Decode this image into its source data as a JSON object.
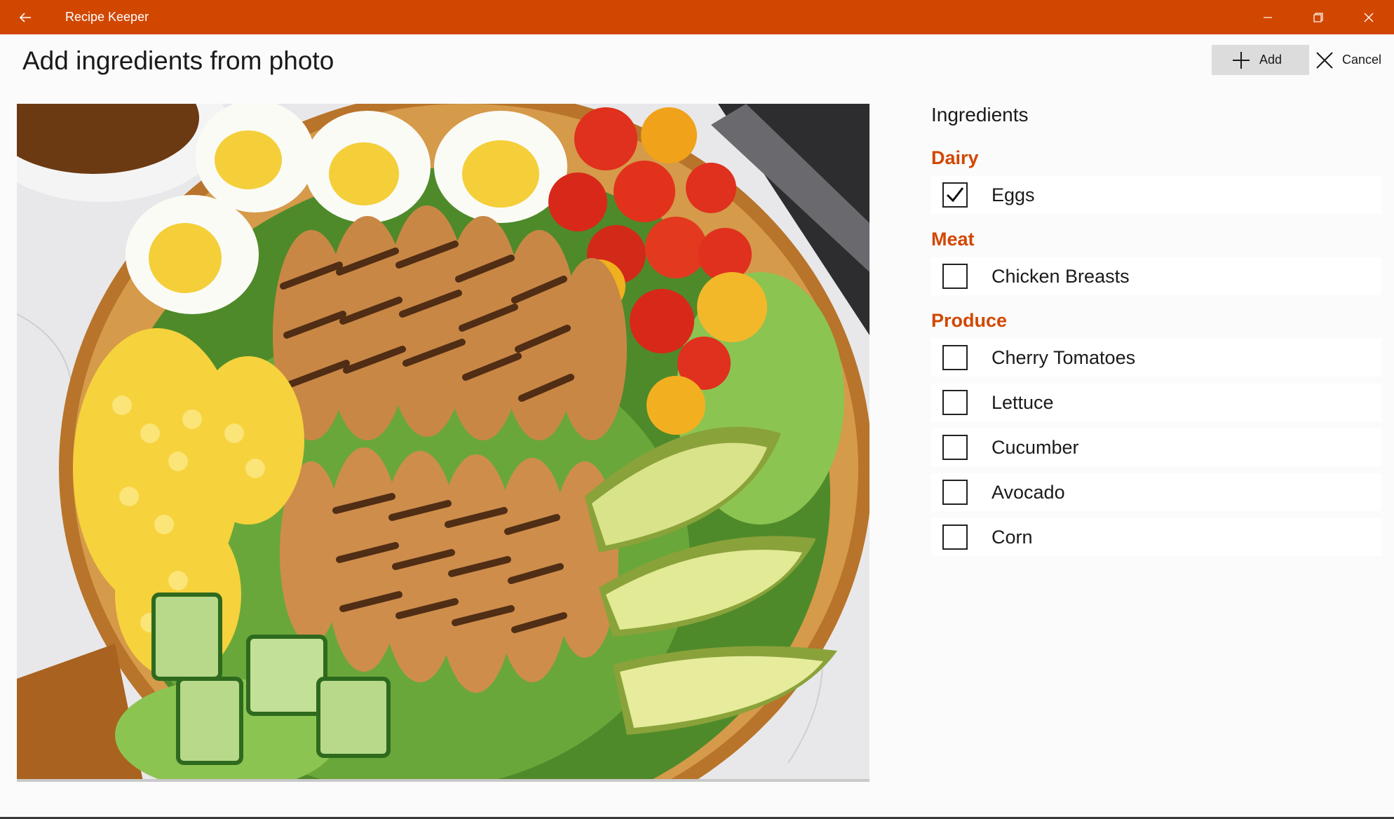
{
  "window": {
    "app_title": "Recipe Keeper",
    "back_icon": "arrow-left-icon",
    "controls": [
      "minimize-icon",
      "restore-icon",
      "close-icon"
    ],
    "accent_color": "#d14700"
  },
  "header": {
    "page_title": "Add ingredients from photo",
    "add_label": "Add",
    "cancel_label": "Cancel"
  },
  "photo": {
    "alt": "Cobb salad with grilled chicken, eggs, cherry tomatoes, avocado, corn and cucumber"
  },
  "ingredients": {
    "heading": "Ingredients",
    "categories": [
      {
        "name": "Dairy",
        "items": [
          {
            "label": "Eggs",
            "checked": true
          }
        ]
      },
      {
        "name": "Meat",
        "items": [
          {
            "label": "Chicken Breasts",
            "checked": false
          }
        ]
      },
      {
        "name": "Produce",
        "items": [
          {
            "label": "Cherry Tomatoes",
            "checked": false
          },
          {
            "label": "Lettuce",
            "checked": false
          },
          {
            "label": "Cucumber",
            "checked": false
          },
          {
            "label": "Avocado",
            "checked": false
          },
          {
            "label": "Corn",
            "checked": false
          }
        ]
      }
    ]
  }
}
